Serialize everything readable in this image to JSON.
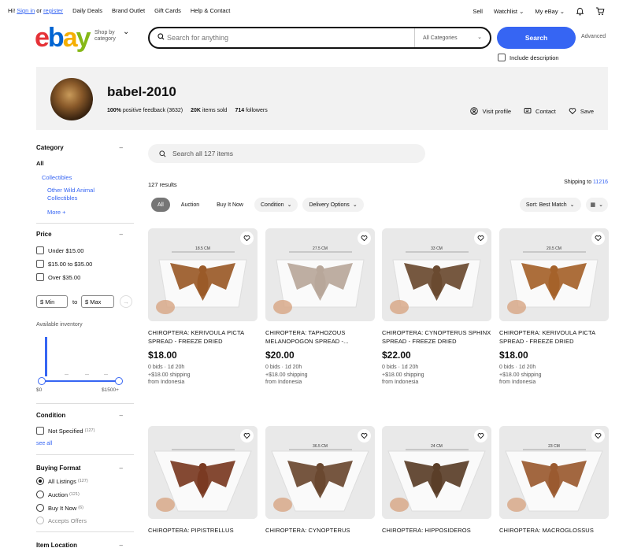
{
  "topnav": {
    "greeting": "Hi!",
    "sign_in": "Sign in",
    "or": "or",
    "register": "register",
    "links": [
      "Daily Deals",
      "Brand Outlet",
      "Gift Cards",
      "Help & Contact"
    ],
    "sell": "Sell",
    "watchlist": "Watchlist",
    "myebay": "My eBay"
  },
  "header": {
    "logo": "ebay",
    "shop_by_line1": "Shop by",
    "shop_by_line2": "category",
    "search_placeholder": "Search for anything",
    "category_select": "All Categories",
    "search_button": "Search",
    "advanced": "Advanced",
    "include_description": "Include description"
  },
  "store": {
    "name": "babel-2010",
    "feedback_pct": "100%",
    "feedback_text": "positive feedback (3632)",
    "items_sold_num": "20K",
    "items_sold_text": "items sold",
    "followers_num": "714",
    "followers_text": "followers",
    "visit_profile": "Visit profile",
    "contact": "Contact",
    "save": "Save"
  },
  "sidebar": {
    "category_title": "Category",
    "all": "All",
    "collectibles": "Collectibles",
    "other_wild_line1": "Other Wild Animal",
    "other_wild_line2": "Collectibles",
    "more": "More +",
    "price_title": "Price",
    "price_options": [
      "Under $15.00",
      "$15.00 to $35.00",
      "Over $35.00"
    ],
    "min_placeholder": "$ Min",
    "to": "to",
    "max_placeholder": "$ Max",
    "available_inventory": "Available inventory",
    "range_min": "$0",
    "range_max": "$1500+",
    "condition_title": "Condition",
    "condition_option": "Not Specified",
    "condition_count": "(127)",
    "see_all": "see all",
    "buying_format_title": "Buying Format",
    "formats": [
      {
        "label": "All Listings",
        "count": "(127)"
      },
      {
        "label": "Auction",
        "count": "(121)"
      },
      {
        "label": "Buy It Now",
        "count": "(6)"
      },
      {
        "label": "Accepts Offers",
        "count": ""
      }
    ],
    "item_location_title": "Item Location"
  },
  "main": {
    "search_placeholder": "Search all 127 items",
    "results": "127 results",
    "shipping_to_label": "Shipping to",
    "shipping_zip": "11216",
    "filters": [
      "All",
      "Auction",
      "Buy It Now",
      "Condition",
      "Delivery Options"
    ],
    "sort": "Sort: Best Match"
  },
  "listings": [
    {
      "title": "CHIROPTERA: KERIVOULA PICTA SPREAD - FREEZE DRIED",
      "price": "$18.00",
      "bids": "0 bids · 1d 20h",
      "shipping": "+$18.00 shipping",
      "from": "from Indonesia",
      "ruler": "18.5 CM",
      "bat_color": "#9a5a28"
    },
    {
      "title": "CHIROPTERA: TAPHOZOUS MELANOPOGON SPREAD -...",
      "price": "$20.00",
      "bids": "0 bids · 1d 20h",
      "shipping": "+$18.00 shipping",
      "from": "from Indonesia",
      "ruler": "27.5 CM",
      "bat_color": "#b8a79a"
    },
    {
      "title": "CHIROPTERA: CYNOPTERUS SPHINX SPREAD - FREEZE DRIED",
      "price": "$22.00",
      "bids": "0 bids · 1d 20h",
      "shipping": "+$18.00 shipping",
      "from": "from Indonesia",
      "ruler": "33 CM",
      "bat_color": "#6a4a30"
    },
    {
      "title": "CHIROPTERA: KERIVOULA PICTA SPREAD - FREEZE DRIED",
      "price": "$18.00",
      "bids": "0 bids · 1d 20h",
      "shipping": "+$18.00 shipping",
      "from": "from Indonesia",
      "ruler": "20.5 CM",
      "bat_color": "#a5622a"
    },
    {
      "title": "CHIROPTERA: PIPISTRELLUS",
      "price": "",
      "bids": "",
      "shipping": "",
      "from": "",
      "ruler": "",
      "bat_color": "#7a3a22"
    },
    {
      "title": "CHIROPTERA: CYNOPTERUS",
      "price": "",
      "bids": "",
      "shipping": "",
      "from": "",
      "ruler": "36.5 CM",
      "bat_color": "#6a4830"
    },
    {
      "title": "CHIROPTERA: HIPPOSIDEROS",
      "price": "",
      "bids": "",
      "shipping": "",
      "from": "",
      "ruler": "24 CM",
      "bat_color": "#5a3e28"
    },
    {
      "title": "CHIROPTERA: MACROGLOSSUS",
      "price": "",
      "bids": "",
      "shipping": "",
      "from": "",
      "ruler": "23 CM",
      "bat_color": "#9a5a30"
    }
  ]
}
